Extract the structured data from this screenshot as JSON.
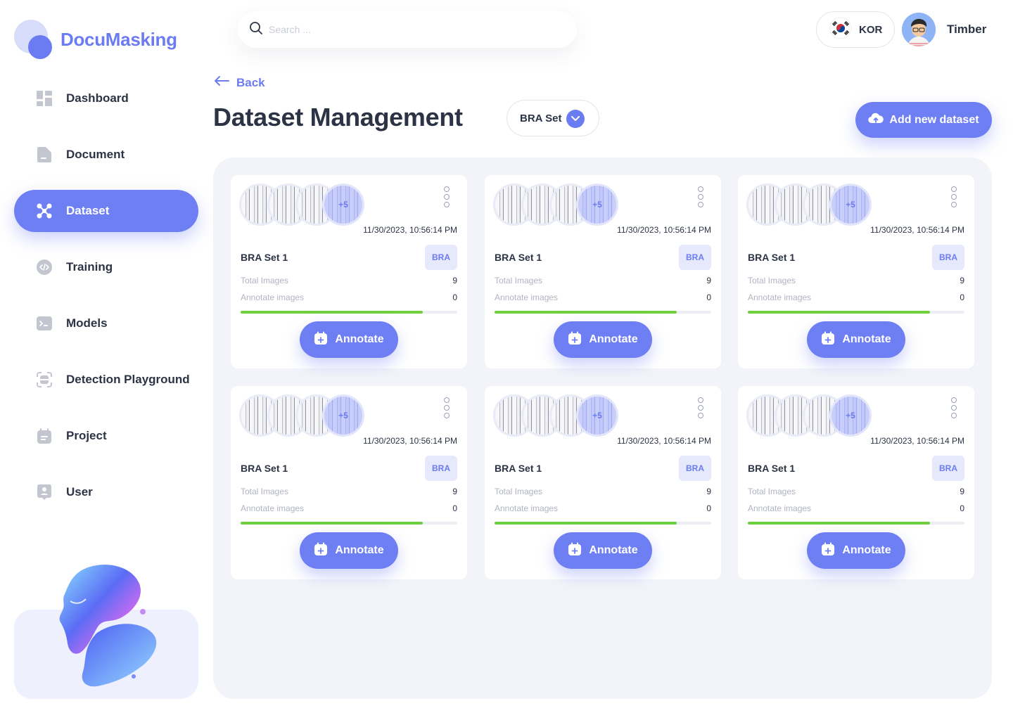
{
  "app": {
    "name": "DocuMasking"
  },
  "sidebar": {
    "items": [
      {
        "label": "Dashboard",
        "icon": "dashboard-icon"
      },
      {
        "label": "Document",
        "icon": "document-icon"
      },
      {
        "label": "Dataset",
        "icon": "dataset-icon",
        "active": true
      },
      {
        "label": "Training",
        "icon": "training-icon"
      },
      {
        "label": "Models",
        "icon": "models-icon"
      },
      {
        "label": "Detection Playground",
        "icon": "detection-icon"
      },
      {
        "label": "Project",
        "icon": "project-icon"
      },
      {
        "label": "User",
        "icon": "user-icon"
      }
    ]
  },
  "header": {
    "search_placeholder": "Search ...",
    "language": "KOR",
    "user": "Timber"
  },
  "page": {
    "back_label": "Back",
    "title": "Dataset Management",
    "set_selected": "BRA Set",
    "add_label": "Add new dataset"
  },
  "colors": {
    "accent": "#6e7ff3",
    "progress": "#6fcf3f",
    "text": "#2b3345"
  },
  "cards": [
    {
      "more": "+5",
      "date": "11/30/2023, 10:56:14 PM",
      "name": "BRA Set 1",
      "tag": "BRA",
      "total_label": "Total Images",
      "total": "9",
      "annotate_label": "Annotate images",
      "annotated": "0",
      "progress": 0.84,
      "button": "Annotate"
    },
    {
      "more": "+5",
      "date": "11/30/2023, 10:56:14 PM",
      "name": "BRA Set 1",
      "tag": "BRA",
      "total_label": "Total Images",
      "total": "9",
      "annotate_label": "Annotate images",
      "annotated": "0",
      "progress": 0.84,
      "button": "Annotate"
    },
    {
      "more": "+5",
      "date": "11/30/2023, 10:56:14 PM",
      "name": "BRA Set 1",
      "tag": "BRA",
      "total_label": "Total Images",
      "total": "9",
      "annotate_label": "Annotate images",
      "annotated": "0",
      "progress": 0.84,
      "button": "Annotate"
    },
    {
      "more": "+5",
      "date": "11/30/2023, 10:56:14 PM",
      "name": "BRA Set 1",
      "tag": "BRA",
      "total_label": "Total Images",
      "total": "9",
      "annotate_label": "Annotate images",
      "annotated": "0",
      "progress": 0.84,
      "button": "Annotate"
    },
    {
      "more": "+5",
      "date": "11/30/2023, 10:56:14 PM",
      "name": "BRA Set 1",
      "tag": "BRA",
      "total_label": "Total Images",
      "total": "9",
      "annotate_label": "Annotate images",
      "annotated": "0",
      "progress": 0.84,
      "button": "Annotate"
    },
    {
      "more": "+5",
      "date": "11/30/2023, 10:56:14 PM",
      "name": "BRA Set 1",
      "tag": "BRA",
      "total_label": "Total Images",
      "total": "9",
      "annotate_label": "Annotate images",
      "annotated": "0",
      "progress": 0.84,
      "button": "Annotate"
    }
  ]
}
